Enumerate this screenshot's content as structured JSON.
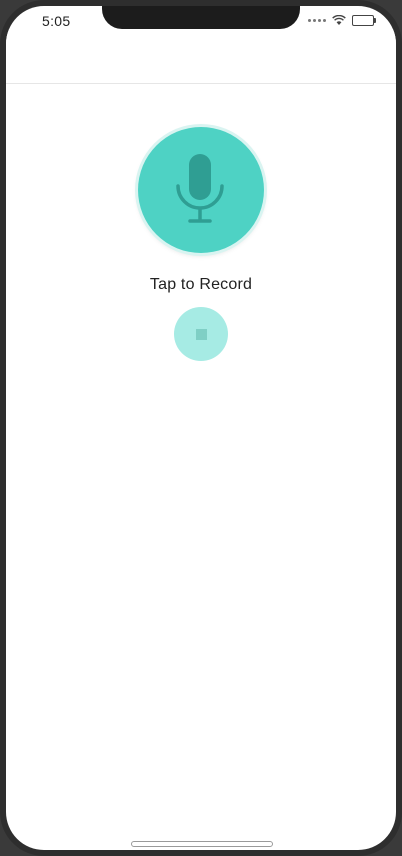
{
  "status_bar": {
    "time": "5:05",
    "icons": [
      "signal-dots-icon",
      "wifi-icon",
      "battery-icon"
    ]
  },
  "recorder": {
    "record_label": "Tap to Record",
    "mic_icon": "microphone-icon",
    "stop_icon": "stop-icon"
  },
  "colors": {
    "accent": "#4ed2c4",
    "accent_light": "#a6ebe4",
    "mic_dark": "#2f9e93"
  }
}
